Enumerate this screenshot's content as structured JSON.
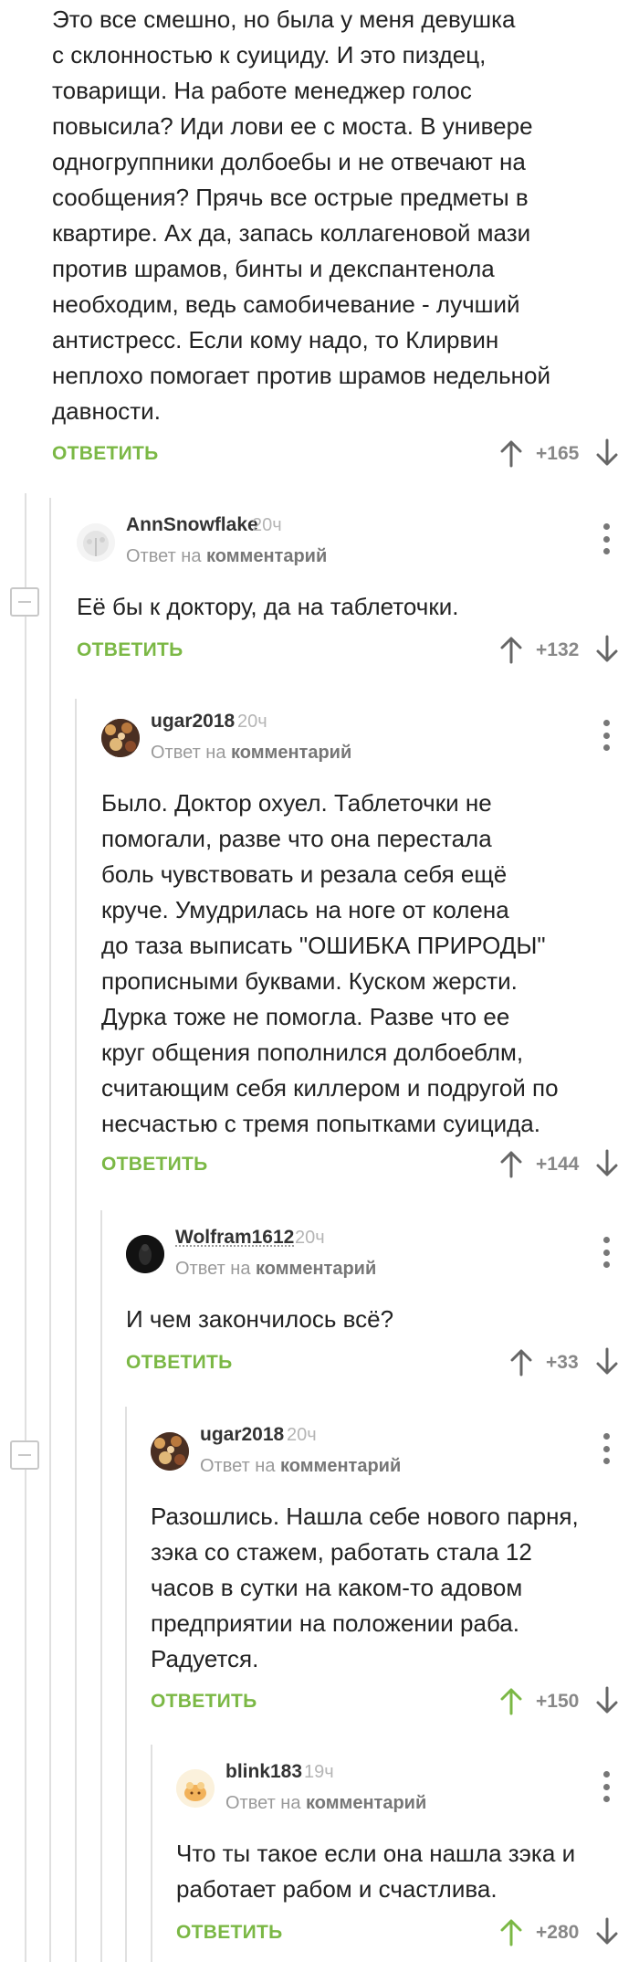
{
  "colors": {
    "accent": "#7bb845",
    "muted": "#888888",
    "thread": "#e0e0e0"
  },
  "comments": [
    {
      "text": [
        "Это все смешно, но была у меня девушка",
        "с склонностью к суициду. И это пиздец,",
        "товарищи. На работе менеджер голос",
        "повысила? Иди лови ее с моста. В универе",
        "одногруппники долбоебы и не отвечают на",
        "сообщения? Прячь все острые предметы в",
        "квартире. Ах да, запась коллагеновой мази",
        "против шрамов, бинты и декспантенола",
        "необходим, ведь самобичевание - лучший",
        "антистресс. Если кому надо, то Клирвин",
        "неплохо помогает против шрамов недельной",
        "давности."
      ],
      "reply_label": "ОТВЕТИТЬ",
      "rating": "+165"
    },
    {
      "author": "AnnSnowflake",
      "time": "20ч",
      "reply_to_prefix": "Ответ на",
      "reply_to_link": "комментарий",
      "text": [
        "Её бы к доктору, да на таблеточки."
      ],
      "reply_label": "ОТВЕТИТЬ",
      "rating": "+132"
    },
    {
      "author": "ugar2018",
      "time": "20ч",
      "reply_to_prefix": "Ответ на",
      "reply_to_link": "комментарий",
      "text": [
        "Было. Доктор охуел. Таблеточки не",
        "помогали, разве что она перестала",
        "боль чувствовать и резала себя ещё",
        "круче. Умудрилась на ноге от колена",
        "до таза выписать \"ОШИБКА ПРИРОДЫ\"",
        "прописными буквами. Куском жерсти.",
        "Дурка тоже не помогла. Разве что ее",
        "круг общения пополнился долбоеблм,",
        "считающим себя киллером и подругой по",
        "несчастью с тремя попытками суицида."
      ],
      "reply_label": "ОТВЕТИТЬ",
      "rating": "+144"
    },
    {
      "author": "Wolfram1612",
      "time": "20ч",
      "reply_to_prefix": "Ответ на",
      "reply_to_link": "комментарий",
      "text": [
        "И чем закончилось всё?"
      ],
      "reply_label": "ОТВЕТИТЬ",
      "rating": "+33"
    },
    {
      "author": "ugar2018",
      "time": "20ч",
      "reply_to_prefix": "Ответ на",
      "reply_to_link": "комментарий",
      "text": [
        "Разошлись. Нашла себе нового парня,",
        "зэка со стажем, работать стала 12",
        "часов в сутки на каком-то адовом",
        "предприятии на положении раба.",
        "Радуется."
      ],
      "reply_label": "ОТВЕТИТЬ",
      "rating": "+150"
    },
    {
      "author": "blink183",
      "time": "19ч",
      "reply_to_prefix": "Ответ на",
      "reply_to_link": "комментарий",
      "text": [
        "Что ты такое если она нашла зэка и",
        "работает рабом и счастлива."
      ],
      "reply_label": "ОТВЕТИТЬ",
      "rating": "+280"
    }
  ]
}
